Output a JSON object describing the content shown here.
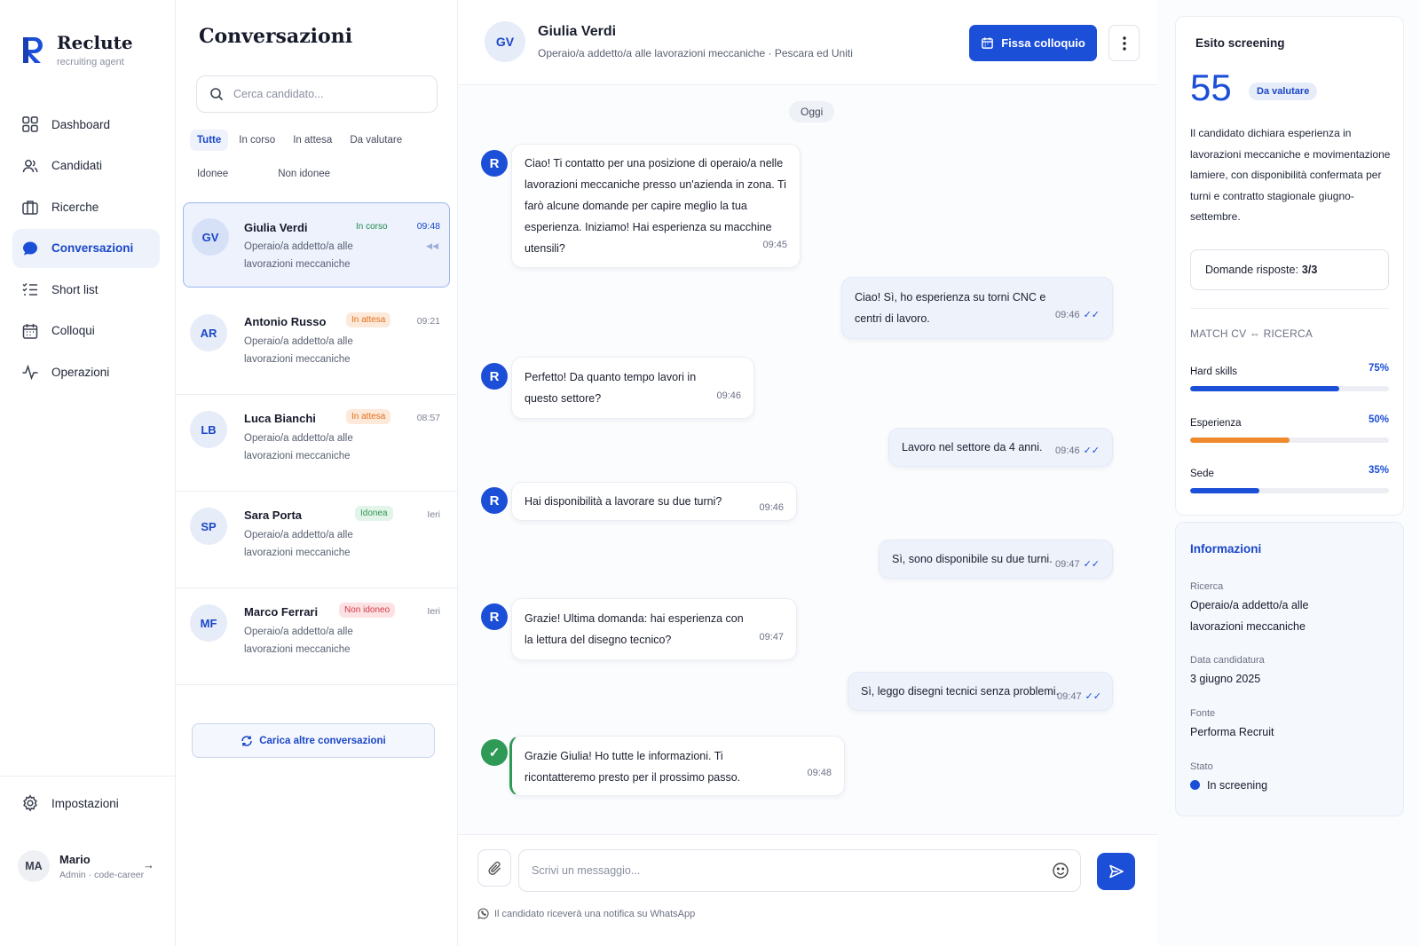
{
  "brand": {
    "name": "Reclute",
    "tagline": "recruiting agent",
    "logo_letter": "R"
  },
  "nav": {
    "items": [
      {
        "label": "Dashboard",
        "icon": "grid-icon"
      },
      {
        "label": "Candidati",
        "icon": "users-icon"
      },
      {
        "label": "Ricerche",
        "icon": "briefcase-icon"
      },
      {
        "label": "Conversazioni",
        "icon": "chat-icon",
        "active": true
      },
      {
        "label": "Short list",
        "icon": "checklist-icon"
      },
      {
        "label": "Colloqui",
        "icon": "calendar-icon"
      },
      {
        "label": "Operazioni",
        "icon": "activity-icon"
      }
    ],
    "settings_label": "Impostazioni"
  },
  "user": {
    "initials": "MA",
    "name": "Mario",
    "role": "Admin · code-career"
  },
  "conversations": {
    "title": "Conversazioni",
    "search_placeholder": "Cerca candidato...",
    "filters": [
      "Tutte",
      "In corso",
      "In attesa",
      "Da valutare",
      "Idonee",
      "Non idonee"
    ],
    "active_filter": "Tutte",
    "items": [
      {
        "initials": "GV",
        "name": "Giulia Verdi",
        "status": "In corso",
        "time": "09:48",
        "role": "Operaio/a addetto/a alle lavorazioni meccaniche"
      },
      {
        "initials": "AR",
        "name": "Antonio Russo",
        "status": "In attesa",
        "time": "09:21",
        "role": "Operaio/a addetto/a alle lavorazioni meccaniche"
      },
      {
        "initials": "LB",
        "name": "Luca Bianchi",
        "status": "In attesa",
        "time": "08:57",
        "role": "Operaio/a addetto/a alle lavorazioni meccaniche"
      },
      {
        "initials": "SP",
        "name": "Sara Porta",
        "status": "Idonea",
        "time": "Ieri",
        "role": "Operaio/a addetto/a alle lavorazioni meccaniche"
      },
      {
        "initials": "MF",
        "name": "Marco Ferrari",
        "status": "Non idoneo",
        "time": "Ieri",
        "role": "Operaio/a addetto/a alle lavorazioni meccaniche"
      }
    ],
    "load_more_label": "Carica altre conversazioni"
  },
  "chat": {
    "candidate_initials": "GV",
    "candidate_name": "Giulia Verdi",
    "subtitle": "Operaio/a addetto/a alle lavorazioni meccaniche · Pescara ed Uniti",
    "schedule_button": "Fissa colloquio",
    "day_label": "Oggi",
    "bot_letter": "R",
    "messages": [
      {
        "from": "bot",
        "text": "Ciao! Ti contatto per una posizione di operaio/a nelle lavorazioni meccaniche presso un'azienda in zona. Ti farò alcune domande per capire meglio la tua esperienza. Iniziamo! Hai esperienza su macchine utensili?",
        "time": "09:45"
      },
      {
        "from": "candidate",
        "text": "Ciao! Sì, ho esperienza su torni CNC e centri di lavoro.",
        "time": "09:46"
      },
      {
        "from": "bot",
        "text": "Perfetto! Da quanto tempo lavori in questo settore?",
        "time": "09:46"
      },
      {
        "from": "candidate",
        "text": "Lavoro nel settore da 4 anni.",
        "time": "09:46"
      },
      {
        "from": "bot",
        "text": "Hai disponibilità a lavorare su due turni?",
        "time": "09:46"
      },
      {
        "from": "candidate",
        "text": "Sì, sono disponibile su due turni.",
        "time": "09:47"
      },
      {
        "from": "bot",
        "text": "Grazie! Ultima domanda: hai esperienza con la lettura del disegno tecnico?",
        "time": "09:47"
      },
      {
        "from": "candidate",
        "text": "Sì, leggo disegni tecnici senza problemi.",
        "time": "09:47"
      },
      {
        "from": "bot",
        "text": "Grazie Giulia! Ho tutte le informazioni. Ti ricontatteremo presto per il prossimo passo.",
        "time": "09:48",
        "final": true
      }
    ],
    "composer_placeholder": "Scrivi un messaggio...",
    "whatsapp_note": "Il candidato riceverà una notifica su WhatsApp"
  },
  "screening": {
    "title": "Esito screening",
    "score": "55",
    "badge": "Da valutare",
    "summary": "Il candidato dichiara esperienza in lavorazioni meccaniche e movimentazione lamiere, con disponibilità confermata per turni e contratto stagionale giugno-settembre.",
    "answered_label": "Domande risposte:",
    "answered_value": "3/3",
    "match_title": "MATCH CV ⇔ RICERCA",
    "match": [
      {
        "label": "Hard skills",
        "percent_label": "75%",
        "value": 75,
        "color": "#1c4fd8"
      },
      {
        "label": "Esperienza",
        "percent_label": "50%",
        "value": 50,
        "color": "#ee8a2c"
      },
      {
        "label": "Sede",
        "percent_label": "35%",
        "value": 35,
        "color": "#1c4fd8"
      }
    ]
  },
  "info": {
    "title": "Informazioni",
    "fields": [
      {
        "label": "Ricerca",
        "value": "Operaio/a addetto/a alle lavorazioni meccaniche"
      },
      {
        "label": "Data candidatura",
        "value": "3 giugno 2025"
      },
      {
        "label": "Fonte",
        "value": "Performa Recruit"
      },
      {
        "label": "Stato",
        "value": "In screening"
      }
    ]
  },
  "colors": {
    "accent": "#1c4fd8",
    "success": "#2f9a55",
    "warning": "#e2701e",
    "danger": "#d33a48"
  }
}
